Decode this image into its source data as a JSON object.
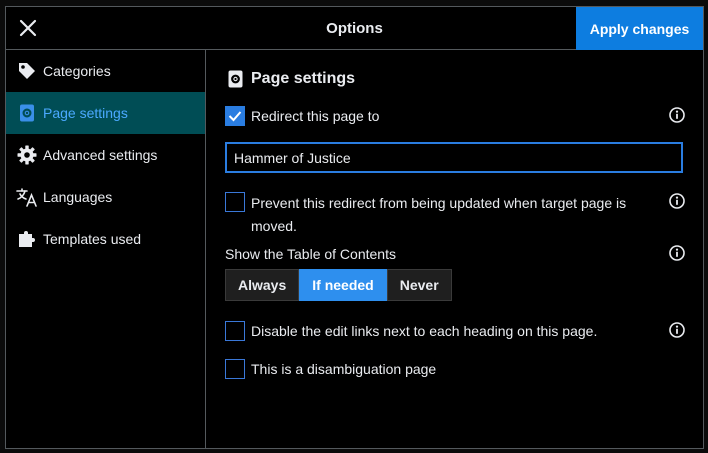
{
  "header": {
    "title": "Options",
    "apply_label": "Apply changes"
  },
  "sidebar": {
    "items": [
      {
        "label": "Categories",
        "icon": "tag-icon"
      },
      {
        "label": "Page settings",
        "icon": "page-settings-icon"
      },
      {
        "label": "Advanced settings",
        "icon": "gear-icon"
      },
      {
        "label": "Languages",
        "icon": "language-icon"
      },
      {
        "label": "Templates used",
        "icon": "puzzle-icon"
      }
    ],
    "active": "Page settings"
  },
  "main": {
    "section_title": "Page settings",
    "redirect_label": "Redirect this page to",
    "redirect_checked": true,
    "redirect_target": "Hammer of Justice",
    "prevent_update_label": "Prevent this redirect from being updated when target page is moved.",
    "prevent_update_checked": false,
    "toc_label": "Show the Table of Contents",
    "toc_options": [
      "Always",
      "If needed",
      "Never"
    ],
    "toc_selected": "If needed",
    "disable_edit_links_label": "Disable the edit links next to each heading on this page.",
    "disable_edit_links_checked": false,
    "disambiguation_label": "This is a disambiguation page",
    "disambiguation_checked": false
  },
  "colors": {
    "accent": "#2a7de1",
    "apply_button": "#0d7de0",
    "active_nav_bg": "#004d55",
    "border": "#54595d"
  }
}
